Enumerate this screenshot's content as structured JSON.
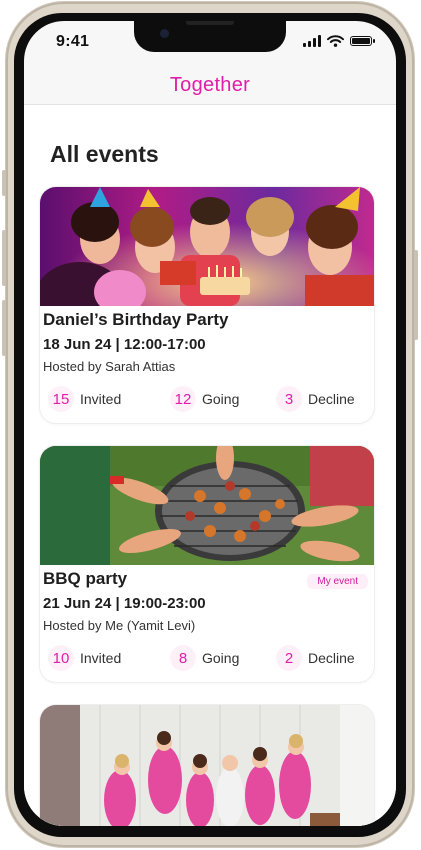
{
  "status_bar": {
    "time": "9:41",
    "battery_level": 0.9
  },
  "header": {
    "title": "Together",
    "accent_color": "#e01ea8"
  },
  "page": {
    "title": "All events"
  },
  "events": [
    {
      "name": "Daniel’s Birthday Party",
      "date": "18 Jun 24 | 12:00-17:00",
      "host": "Hosted by Sarah Attias",
      "badge": "",
      "invited": "15",
      "invited_label": "Invited",
      "going": "12",
      "going_label": "Going",
      "decline": "3",
      "decline_label": "Decline"
    },
    {
      "name": "BBQ party",
      "date": "21 Jun 24 | 19:00-23:00",
      "host": "Hosted by Me (Yamit Levi)",
      "badge": "My event",
      "invited": "10",
      "invited_label": "Invited",
      "going": "8",
      "going_label": "Going",
      "decline": "2",
      "decline_label": "Decline"
    }
  ],
  "icons": {
    "signal": "cellular-signal-icon",
    "wifi": "wifi-icon",
    "battery": "battery-icon"
  }
}
